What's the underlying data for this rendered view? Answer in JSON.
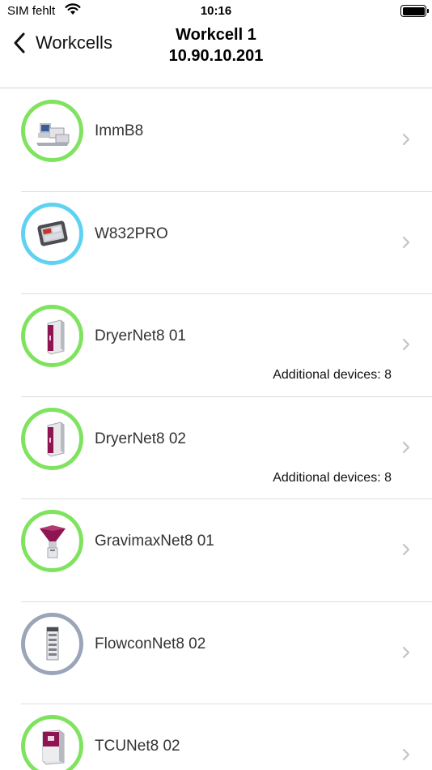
{
  "status_bar": {
    "carrier": "SIM fehlt",
    "time": "10:16",
    "battery_level": 1.0
  },
  "nav": {
    "back_label": "Workcells",
    "title": "Workcell 1",
    "subtitle": "10.90.10.201"
  },
  "colors": {
    "ring_green": "#7fe35f",
    "ring_blue": "#5fd2f2",
    "ring_gray": "#9aa5b8",
    "chevron": "#c4c4c7",
    "device_magenta": "#8e1552"
  },
  "devices": [
    {
      "name": "ImmB8",
      "additional": "",
      "status": "green",
      "icon": "injection-molding-machine-icon"
    },
    {
      "name": "W832PRO",
      "additional": "",
      "status": "blue",
      "icon": "tablet-controller-icon"
    },
    {
      "name": "DryerNet8 01",
      "additional": "Additional devices: 8",
      "status": "green",
      "icon": "dryer-cabinet-icon"
    },
    {
      "name": "DryerNet8 02",
      "additional": "Additional devices: 8",
      "status": "green",
      "icon": "dryer-cabinet-icon"
    },
    {
      "name": "GravimaxNet8 01",
      "additional": "",
      "status": "green",
      "icon": "gravimetric-blender-icon"
    },
    {
      "name": "FlowconNet8 02",
      "additional": "",
      "status": "gray",
      "icon": "flow-controller-icon"
    },
    {
      "name": "TCUNet8 02",
      "additional": "",
      "status": "green",
      "icon": "temperature-control-unit-icon"
    }
  ]
}
